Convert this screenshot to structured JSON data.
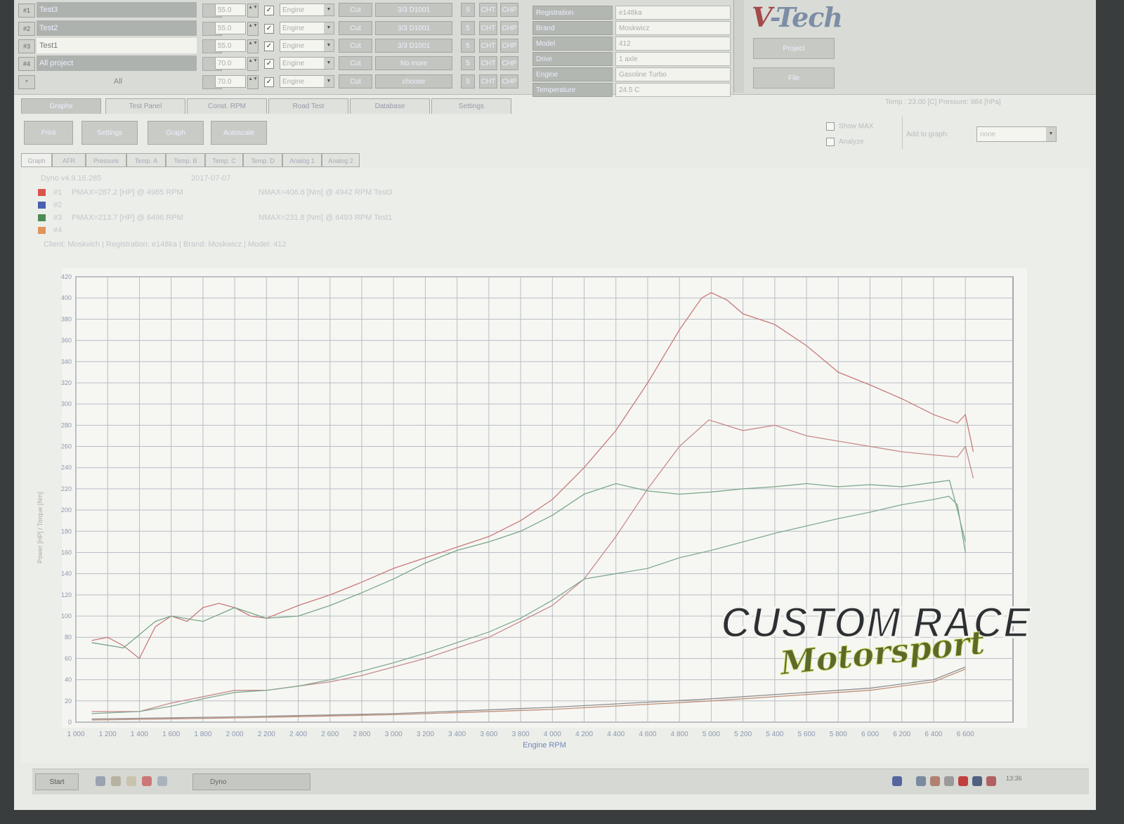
{
  "tests": [
    {
      "num": "#1",
      "name": "Test3",
      "value": "55.0",
      "checked": true,
      "source": "Engine",
      "cut": "Cut",
      "time": "3/3 D1001",
      "n": "5",
      "c1": "CHT",
      "c2": "CHP",
      "selected": false
    },
    {
      "num": "#2",
      "name": "Test2",
      "value": "55.0",
      "checked": true,
      "source": "Engine",
      "cut": "Cut",
      "time": "3/3 D1001",
      "n": "5",
      "c1": "CHT",
      "c2": "CHP",
      "selected": false
    },
    {
      "num": "#3",
      "name": "Test1",
      "value": "55.0",
      "checked": true,
      "source": "Engine",
      "cut": "Cut",
      "time": "3/3 D1001",
      "n": "5",
      "c1": "CHT",
      "c2": "CHP",
      "selected": true
    },
    {
      "num": "#4",
      "name": "All project",
      "value": "70.0",
      "checked": true,
      "source": "Engine",
      "cut": "Cut",
      "time": "No more",
      "n": "5",
      "c1": "CHT",
      "c2": "CHP",
      "selected": false
    },
    {
      "num": "*",
      "name": "All",
      "value": "70.0",
      "checked": true,
      "source": "Engine",
      "cut": "Cut",
      "time": "choose",
      "n": "5",
      "c1": "CHT",
      "c2": "CHP",
      "selected": false
    }
  ],
  "vehicle": [
    {
      "label": "Registration",
      "value": "e148ka"
    },
    {
      "label": "Brand",
      "value": "Moskwicz"
    },
    {
      "label": "Model",
      "value": "412"
    },
    {
      "label": "Drive",
      "value": "1 axle"
    },
    {
      "label": "Engine",
      "value": "Gasoline Turbo"
    },
    {
      "label": "Temperature",
      "value": "24.5 C"
    }
  ],
  "logo": {
    "prefix": "V",
    "rest": "-Tech"
  },
  "side_buttons": [
    "Project",
    "File"
  ],
  "main_tabs": [
    "Graphs",
    "Test Panel",
    "Const. RPM",
    "Road Test",
    "Database",
    "Settings"
  ],
  "status_line": "Temp : 23.00 [C]   Pressure: 984 [hPa]",
  "action_buttons": [
    "Print",
    "Settings",
    "Graph",
    "Autoscale"
  ],
  "options": {
    "show_max": "Show MAX",
    "analyze": "Analyze",
    "add_to_graph": "Add to graph:",
    "add_to_graph_value": "none"
  },
  "sub_tabs": [
    "Graph",
    "AFR",
    "Pressure",
    "Temp. A",
    "Temp. B",
    "Temp. C",
    "Temp. D",
    "Analog 1",
    "Analog 2"
  ],
  "graph_header": {
    "version": "Dyno v4.9.16.285",
    "date": "2017-07-07"
  },
  "legend": [
    {
      "id": "#1",
      "text": "PMAX=287.2 [HP] @ 4985 RPM",
      "text2": "NMAX=406.6 [Nm] @ 4942 RPM   Test3",
      "color": "#d9534f"
    },
    {
      "id": "#2",
      "text": "",
      "text2": "",
      "color": "#4a5fb0"
    },
    {
      "id": "#3",
      "text": "PMAX=213.7 [HP] @ 6496 RPM",
      "text2": "NMAX=231.8 [Nm] @ 6493 RPM   Test1",
      "color": "#4d8a55"
    },
    {
      "id": "#4",
      "text": "",
      "text2": "",
      "color": "#e0935a"
    }
  ],
  "client_line": "Client: Moskvich | Registration: e148ka | Brand: Moskwicz | Model: 412",
  "watermark": {
    "line1": "CUSTOM RACE",
    "line2": "Motorsport"
  },
  "taskbar": {
    "start": "Start",
    "item": "Dyno",
    "clock": "13:36"
  },
  "chart_data": {
    "type": "line",
    "xlabel": "Engine RPM",
    "ylabel": "Power [HP] / Torque [Nm]",
    "xlim": [
      1000,
      6900
    ],
    "ylim": [
      0,
      420
    ],
    "x_ticks": [
      "1 000",
      "1 200",
      "1 400",
      "1 600",
      "1 800",
      "2 000",
      "2 200",
      "2 400",
      "2 600",
      "2 800",
      "3 000",
      "3 200",
      "3 400",
      "3 600",
      "3 800",
      "4 000",
      "4 200",
      "4 400",
      "4 600",
      "4 800",
      "5 000",
      "5 200",
      "5 400",
      "5 600",
      "5 800",
      "6 000",
      "6 200",
      "6 400",
      "6 600"
    ],
    "y_ticks": [
      "0",
      "20",
      "40",
      "60",
      "80",
      "100",
      "120",
      "140",
      "160",
      "180",
      "200",
      "220",
      "240",
      "260",
      "280",
      "300",
      "320",
      "340",
      "360",
      "380",
      "400",
      "420"
    ],
    "grid": true,
    "series": [
      {
        "name": "#1 torque",
        "color": "#c97a7a",
        "x": [
          1100,
          1200,
          1300,
          1400,
          1500,
          1600,
          1700,
          1800,
          1900,
          2000,
          2100,
          2200,
          2400,
          2600,
          2800,
          3000,
          3200,
          3400,
          3600,
          3800,
          4000,
          4200,
          4400,
          4600,
          4800,
          4940,
          5000,
          5100,
          5200,
          5400,
          5600,
          5800,
          6000,
          6200,
          6400,
          6550,
          6600,
          6650
        ],
        "y": [
          77,
          80,
          72,
          60,
          90,
          100,
          95,
          108,
          112,
          108,
          100,
          98,
          110,
          120,
          132,
          145,
          155,
          165,
          175,
          190,
          210,
          240,
          275,
          320,
          370,
          400,
          405,
          398,
          385,
          375,
          355,
          330,
          318,
          305,
          290,
          282,
          290,
          255
        ]
      },
      {
        "name": "#1 power",
        "color": "#c88b8b",
        "x": [
          1100,
          1400,
          1600,
          1800,
          2000,
          2200,
          2400,
          2600,
          2800,
          3000,
          3200,
          3400,
          3600,
          3800,
          4000,
          4200,
          4400,
          4600,
          4800,
          4985,
          5200,
          5400,
          5600,
          5800,
          6000,
          6200,
          6400,
          6550,
          6600,
          6650
        ],
        "y": [
          10,
          10,
          18,
          24,
          30,
          30,
          34,
          38,
          44,
          52,
          60,
          70,
          80,
          95,
          110,
          135,
          175,
          220,
          260,
          285,
          275,
          280,
          270,
          265,
          260,
          255,
          252,
          250,
          260,
          230
        ]
      },
      {
        "name": "#3 torque",
        "color": "#7aa68a",
        "x": [
          1100,
          1300,
          1500,
          1600,
          1800,
          2000,
          2200,
          2400,
          2600,
          2800,
          3000,
          3200,
          3400,
          3600,
          3800,
          4000,
          4200,
          4400,
          4600,
          4800,
          5000,
          5200,
          5400,
          5600,
          5800,
          6000,
          6200,
          6400,
          6500,
          6550,
          6600
        ],
        "y": [
          75,
          70,
          95,
          100,
          95,
          108,
          98,
          100,
          110,
          122,
          135,
          150,
          162,
          170,
          180,
          195,
          215,
          225,
          218,
          215,
          217,
          220,
          222,
          225,
          222,
          224,
          222,
          226,
          228,
          200,
          170
        ]
      },
      {
        "name": "#3 power",
        "color": "#83a994",
        "x": [
          1100,
          1400,
          1600,
          1800,
          2000,
          2200,
          2400,
          2600,
          2800,
          3000,
          3200,
          3400,
          3600,
          3800,
          4000,
          4200,
          4400,
          4600,
          4800,
          5000,
          5200,
          5400,
          5600,
          5800,
          6000,
          6200,
          6400,
          6496,
          6550,
          6600
        ],
        "y": [
          8,
          10,
          15,
          22,
          28,
          30,
          34,
          40,
          48,
          56,
          65,
          75,
          85,
          98,
          115,
          135,
          140,
          145,
          155,
          162,
          170,
          178,
          185,
          192,
          198,
          205,
          210,
          213,
          205,
          160
        ]
      },
      {
        "name": "loss 1",
        "color": "#8f8f8f",
        "x": [
          1100,
          2000,
          3000,
          4000,
          5000,
          6000,
          6400,
          6600
        ],
        "y": [
          3,
          5,
          8,
          14,
          22,
          32,
          40,
          52
        ]
      },
      {
        "name": "loss 2",
        "color": "#c08f7a",
        "x": [
          1100,
          2000,
          3000,
          4000,
          5000,
          6000,
          6400,
          6600
        ],
        "y": [
          2,
          4,
          7,
          12,
          20,
          30,
          38,
          50
        ]
      }
    ]
  }
}
